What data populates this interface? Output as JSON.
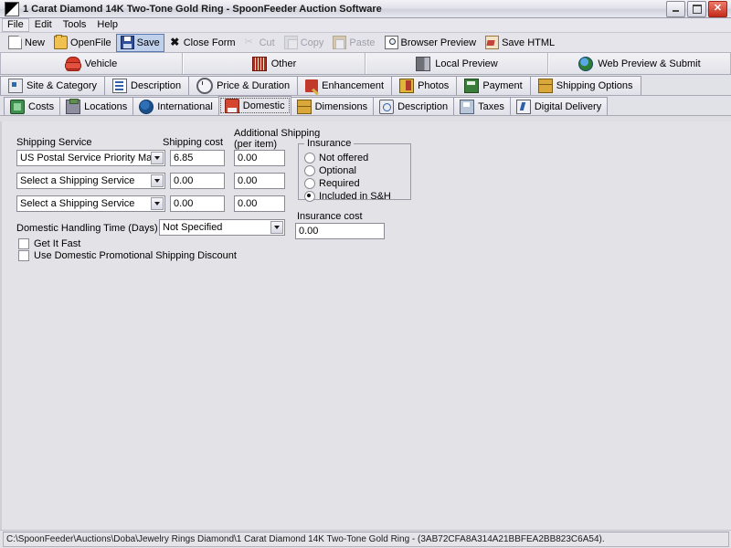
{
  "window": {
    "title": "1 Carat Diamond 14K Two-Tone Gold Ring - SpoonFeeder Auction Software",
    "app_icon": "app-icon",
    "minimize_label": "",
    "maximize_label": "",
    "close_label": "✕"
  },
  "menu": {
    "items": [
      "File",
      "Edit",
      "Tools",
      "Help"
    ]
  },
  "toolbar": {
    "buttons": [
      {
        "label": "New",
        "icon": "new-document-icon",
        "state": "normal",
        "underline": "N"
      },
      {
        "label": "OpenFile",
        "icon": "open-folder-icon",
        "state": "normal",
        "underline": "O"
      },
      {
        "label": "Save",
        "icon": "floppy-disk-icon",
        "state": "pressed",
        "underline": "S"
      },
      {
        "label": "Close Form",
        "icon": "close-x-icon",
        "state": "normal",
        "underline": ""
      },
      {
        "label": "Cut",
        "icon": "scissors-icon",
        "state": "disabled",
        "underline": "t"
      },
      {
        "label": "Copy",
        "icon": "copy-icon",
        "state": "disabled",
        "underline": "C"
      },
      {
        "label": "Paste",
        "icon": "clipboard-paste-icon",
        "state": "disabled",
        "underline": "P"
      },
      {
        "label": "Browser Preview",
        "icon": "magnifier-page-icon",
        "state": "normal",
        "underline": "B"
      },
      {
        "label": "Save HTML",
        "icon": "save-html-icon",
        "state": "normal",
        "underline": "a"
      }
    ]
  },
  "tabs_primary": [
    {
      "label": "Vehicle",
      "icon": "vehicle-icon"
    },
    {
      "label": "Other",
      "icon": "barcode-icon"
    },
    {
      "label": "Local Preview",
      "icon": "document-preview-icon"
    },
    {
      "label": "Web Preview & Submit",
      "icon": "globe-icon"
    }
  ],
  "tabs_secondary": [
    {
      "label": "Site & Category",
      "icon": "sitemap-icon"
    },
    {
      "label": "Description",
      "icon": "description-icon"
    },
    {
      "label": "Price & Duration",
      "icon": "clock-icon"
    },
    {
      "label": "Enhancement",
      "icon": "wand-icon"
    },
    {
      "label": "Photos",
      "icon": "photos-icon"
    },
    {
      "label": "Payment",
      "icon": "payment-icon"
    },
    {
      "label": "Shipping Options",
      "icon": "package-icon"
    }
  ],
  "tabs_shipping": [
    {
      "label": "Costs",
      "icon": "money-icon",
      "active": false
    },
    {
      "label": "Locations",
      "icon": "locations-icon",
      "active": false
    },
    {
      "label": "International",
      "icon": "globe-blue-icon",
      "active": false
    },
    {
      "label": "Domestic",
      "icon": "house-icon",
      "active": true
    },
    {
      "label": "Dimensions",
      "icon": "box-icon",
      "active": false
    },
    {
      "label": "Description",
      "icon": "doc-pen-icon",
      "active": false
    },
    {
      "label": "Taxes",
      "icon": "tax-icon",
      "active": false
    },
    {
      "label": "Digital Delivery",
      "icon": "digital-icon",
      "active": false
    }
  ],
  "form": {
    "headers": {
      "shipping_service": "Shipping Service",
      "shipping_cost": "Shipping cost",
      "additional_shipping_line1": "Additional Shipping",
      "additional_shipping_line2": "(per item)"
    },
    "rows": [
      {
        "service": "US Postal Service Priority Mail",
        "cost": "6.85",
        "additional": "0.00"
      },
      {
        "service": "Select a Shipping Service",
        "cost": "0.00",
        "additional": "0.00"
      },
      {
        "service": "Select a Shipping Service",
        "cost": "0.00",
        "additional": "0.00"
      }
    ],
    "handling_time_label": "Domestic Handling Time (Days)",
    "handling_time_value": "Not Specified",
    "checkboxes": [
      {
        "label": "Get It Fast",
        "checked": false
      },
      {
        "label": "Use Domestic Promotional Shipping Discount",
        "checked": false
      }
    ],
    "insurance": {
      "title": "Insurance",
      "options": [
        {
          "label": "Not offered",
          "selected": false
        },
        {
          "label": "Optional",
          "selected": false
        },
        {
          "label": "Required",
          "selected": false
        },
        {
          "label": "Included in S&H",
          "selected": true
        }
      ],
      "cost_label": "Insurance cost",
      "cost_value": "0.00"
    }
  },
  "statusbar": {
    "path": "C:\\SpoonFeeder\\Auctions\\Doba\\Jewelry Rings Diamond\\1 Carat Diamond 14K Two-Tone Gold Ring - (3AB72CFA8A314A21BBFEA2BB823C6A54)."
  },
  "colors": {
    "window_bg": "#dfdfe3",
    "client_bg": "#e2e2e7",
    "pressed_button": "#bfd0ea",
    "close_button": "#c32d1c",
    "field_bg": "#ffffff"
  }
}
